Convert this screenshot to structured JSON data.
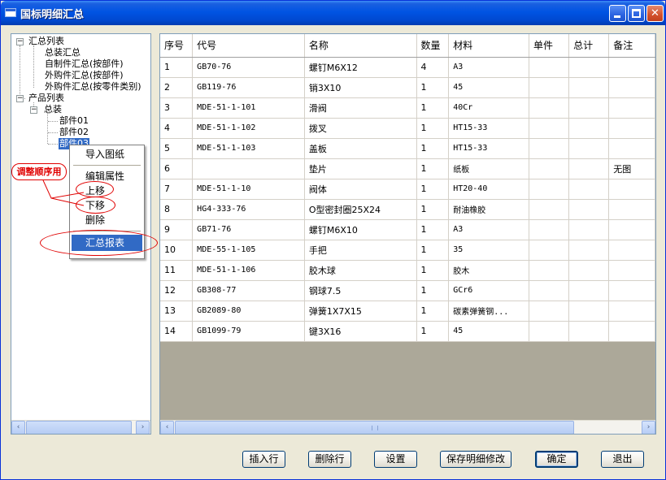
{
  "window": {
    "title": "国标明细汇总"
  },
  "tree": {
    "nodes": [
      {
        "label": "汇总列表",
        "expander": "−"
      },
      {
        "label": "总装汇总"
      },
      {
        "label": "自制件汇总(按部件)"
      },
      {
        "label": "外购件汇总(按部件)"
      },
      {
        "label": "外购件汇总(按零件类别)"
      },
      {
        "label": "产品列表",
        "expander": "−"
      },
      {
        "label": "总装",
        "expander": "−"
      },
      {
        "label": "部件01"
      },
      {
        "label": "部件02"
      },
      {
        "label": "部件03"
      }
    ]
  },
  "context_menu": {
    "items": [
      "导入图纸",
      "编辑属性",
      "上移",
      "下移",
      "删除",
      "汇总报表"
    ],
    "highlighted": "汇总报表"
  },
  "annotation": {
    "callout": "调整顺序用"
  },
  "grid": {
    "columns": [
      "序号",
      "代号",
      "名称",
      "数量",
      "材料",
      "单件",
      "总计",
      "备注"
    ],
    "rows": [
      [
        "1",
        "GB70-76",
        "螺钉M6X12",
        "4",
        "A3",
        "",
        "",
        ""
      ],
      [
        "2",
        "GB119-76",
        "销3X10",
        "1",
        "45",
        "",
        "",
        ""
      ],
      [
        "3",
        "MDE-51-1-101",
        "滑阀",
        "1",
        "40Cr",
        "",
        "",
        ""
      ],
      [
        "4",
        "MDE-51-1-102",
        "拨叉",
        "1",
        "HT15-33",
        "",
        "",
        ""
      ],
      [
        "5",
        "MDE-51-1-103",
        "盖板",
        "1",
        "HT15-33",
        "",
        "",
        ""
      ],
      [
        "6",
        "",
        "垫片",
        "1",
        "纸板",
        "",
        "",
        "无图"
      ],
      [
        "7",
        "MDE-51-1-10",
        "阀体",
        "1",
        "HT20-40",
        "",
        "",
        ""
      ],
      [
        "8",
        "HG4-333-76",
        "O型密封圈25X24",
        "1",
        "耐油橡胶",
        "",
        "",
        ""
      ],
      [
        "9",
        "GB71-76",
        "螺钉M6X10",
        "1",
        "A3",
        "",
        "",
        ""
      ],
      [
        "10",
        "MDE-55-1-105",
        "手把",
        "1",
        "35",
        "",
        "",
        ""
      ],
      [
        "11",
        "MDE-51-1-106",
        "胶木球",
        "1",
        "胶木",
        "",
        "",
        ""
      ],
      [
        "12",
        "GB308-77",
        "钢球7.5",
        "1",
        "GCr6",
        "",
        "",
        ""
      ],
      [
        "13",
        "GB2089-80",
        "弹簧1X7X15",
        "1",
        "碳素弹簧钢...",
        "",
        "",
        ""
      ],
      [
        "14",
        "GB1099-79",
        "键3X16",
        "1",
        "45",
        "",
        "",
        ""
      ]
    ]
  },
  "buttons": {
    "insert_row": "插入行",
    "delete_row": "删除行",
    "settings": "设置",
    "save": "保存明细修改",
    "ok": "确定",
    "exit": "退出"
  },
  "scroll_glyphs": {
    "left": "‹",
    "right": "›",
    "up": "^"
  },
  "colors": {
    "title_bar": "#0054e3",
    "selection": "#316ac5",
    "annotation_red": "#e00000"
  }
}
